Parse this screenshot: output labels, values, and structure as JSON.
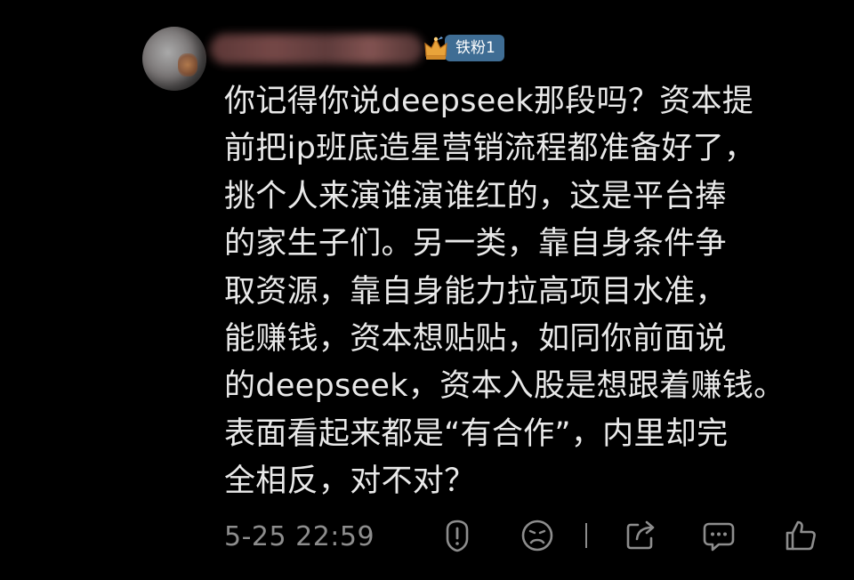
{
  "comment": {
    "fan_badge": "铁粉1",
    "lines": [
      "你记得你说deepseek那段吗？资本提",
      "前把ip班底造星营销流程都准备好了，",
      "挑个人来演谁演谁红的，这是平台捧",
      "的家生子们。另一类，靠自身条件争",
      "取资源，靠自身能力拉高项目水准，",
      "能赚钱，资本想贴贴，如同你前面说",
      "的deepseek，资本入股是想跟着赚钱。",
      "表面看起来都是“有合作”，内里却完",
      "全相反，对不对？"
    ],
    "timestamp": "5-25 22:59"
  },
  "actions": {
    "icons": [
      "report-icon",
      "dislike-icon",
      "share-icon",
      "reply-icon",
      "like-icon"
    ]
  },
  "colors": {
    "background": "#000000",
    "text": "#e9e9e9",
    "meta": "#8d8d8d",
    "badge": "#3f6d94",
    "crown": "#e8a33a"
  }
}
